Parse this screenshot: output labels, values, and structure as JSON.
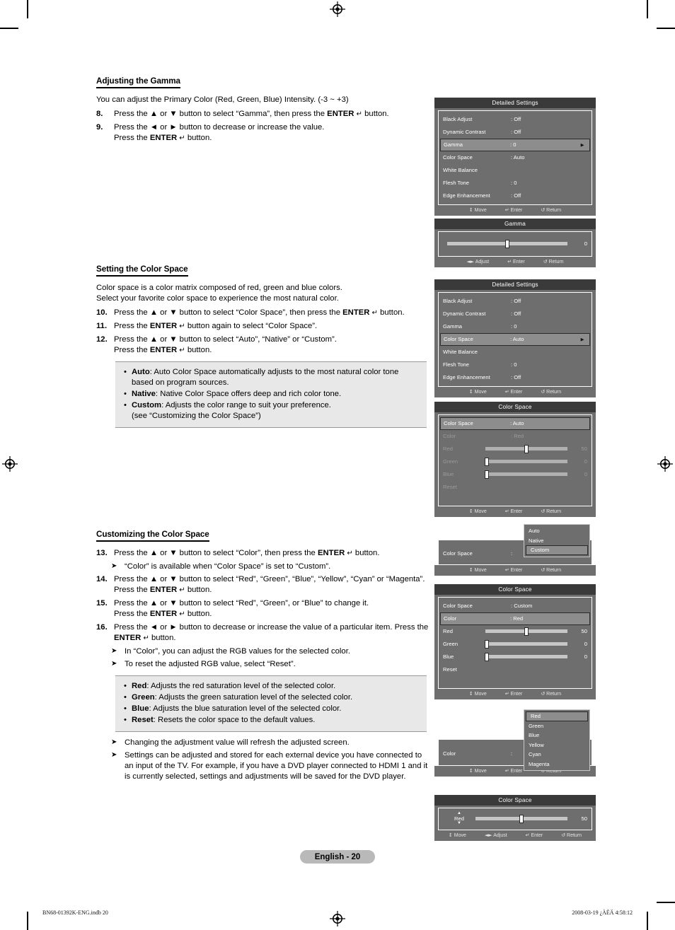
{
  "document": {
    "page_badge": "English - 20",
    "footer_left": "BN68-01392K-ENG.indb  20",
    "footer_right": "2008-03-19   ¿ÀÈÄ 4:58:12"
  },
  "sections": {
    "gamma": {
      "heading": "Adjusting the Gamma",
      "lead": "You can adjust the Primary Color (Red, Green, Blue) Intensity. (-3 ~ +3)",
      "steps": [
        {
          "num": "8.",
          "html": "Press the ▲ or ▼ button to select “Gamma”, then press the <b>ENTER</b> <span class=\"ent\">↵</span> button."
        },
        {
          "num": "9.",
          "html": "Press the ◄ or ► button to decrease or increase the value.<br>Press the <b>ENTER</b> <span class=\"ent\">↵</span> button."
        }
      ]
    },
    "color_space": {
      "heading": "Setting the Color Space",
      "lead": "Color space is a color matrix composed of red, green and blue colors.<br>Select your favorite color space to experience the most natural color.",
      "steps": [
        {
          "num": "10.",
          "html": "Press the ▲ or ▼ button to select “Color Space”, then press the <b>ENTER</b> <span class=\"ent\">↵</span> button."
        },
        {
          "num": "11.",
          "html": "Press the <b>ENTER</b> <span class=\"ent\">↵</span> button again to select “Color Space”."
        },
        {
          "num": "12.",
          "html": "Press the ▲ or ▼ button to select “Auto”, “Native” or “Custom”.<br>Press the <b>ENTER</b> <span class=\"ent\">↵</span> button."
        }
      ],
      "notebox": [
        "<b>Auto</b>: Auto Color Space automatically adjusts to the most natural color tone based on program sources.",
        "<b>Native</b>: Native Color Space offers deep and rich color tone.",
        "<b>Custom</b>: Adjusts the color range to suit your preference.<br>(see “Customizing the Color Space”)"
      ]
    },
    "customizing": {
      "heading": "Customizing the Color Space",
      "steps": [
        {
          "num": "13.",
          "html": "Press the ▲ or ▼ button to select “Color”, then press the <b>ENTER</b> <span class=\"ent\">↵</span> button."
        },
        {
          "note": "“Color” is available when “Color Space” is set to “Custom”."
        },
        {
          "num": "14.",
          "html": "Press the ▲ or ▼ button to select “Red”, “Green”, “Blue”, “Yellow”, “Cyan” or “Magenta”. Press the <b>ENTER</b> <span class=\"ent\">↵</span> button."
        },
        {
          "num": "15.",
          "html": "Press the ▲ or ▼ button to select “Red”, “Green”, or “Blue” to change it.<br>Press the <b>ENTER</b> <span class=\"ent\">↵</span> button."
        },
        {
          "num": "16.",
          "html": "Press the ◄ or ► button to decrease or increase the value of a particular item. Press the <b>ENTER</b> <span class=\"ent\">↵</span> button."
        },
        {
          "note": "In “Color”, you can adjust the RGB values for the selected color."
        },
        {
          "note": "To reset the adjusted RGB value, select “Reset”."
        }
      ],
      "notebox": [
        "<b>Red</b>: Adjusts the red saturation level of the selected color.",
        "<b>Green</b>: Adjusts the green saturation level of the selected color.",
        "<b>Blue</b>: Adjusts the blue saturation level of the selected color.",
        "<b>Reset</b>: Resets the color space to the default values."
      ],
      "tail_notes": [
        "Changing the adjustment value will refresh the adjusted screen.",
        "Settings can be adjusted and stored for each external device you have connected to an input of the TV. For example, if you have a DVD player connected to HDMI 1 and it is currently selected, settings and adjustments will be saved for the DVD player."
      ]
    }
  },
  "osd_common": {
    "footer_move": "Move",
    "footer_adjust": "Adjust",
    "footer_enter": "Enter",
    "footer_return": "Return"
  },
  "osd": {
    "detailed_settings_1": {
      "title": "Detailed Settings",
      "rows": [
        {
          "label": "Black Adjust",
          "value": ": Off",
          "selected": false
        },
        {
          "label": "Dynamic Contrast",
          "value": ": Off",
          "selected": false
        },
        {
          "label": "Gamma",
          "value": ": 0",
          "selected": true
        },
        {
          "label": "Color Space",
          "value": ": Auto",
          "selected": false
        },
        {
          "label": "White Balance",
          "value": "",
          "selected": false
        },
        {
          "label": "Flesh Tone",
          "value": ": 0",
          "selected": false
        },
        {
          "label": "Edge Enhancement",
          "value": ": Off",
          "selected": false
        }
      ]
    },
    "gamma_slider": {
      "title": "Gamma",
      "value": "0",
      "knob_percent": 50
    },
    "detailed_settings_2": {
      "title": "Detailed Settings",
      "rows": [
        {
          "label": "Black Adjust",
          "value": ": Off",
          "selected": false
        },
        {
          "label": "Dynamic Contrast",
          "value": ": Off",
          "selected": false
        },
        {
          "label": "Gamma",
          "value": ": 0",
          "selected": false
        },
        {
          "label": "Color Space",
          "value": ": Auto",
          "selected": true
        },
        {
          "label": "White Balance",
          "value": "",
          "selected": false
        },
        {
          "label": "Flesh Tone",
          "value": ": 0",
          "selected": false
        },
        {
          "label": "Edge Enhancement",
          "value": ": Off",
          "selected": false
        }
      ]
    },
    "color_space_auto": {
      "title": "Color Space",
      "rows": [
        {
          "label": "Color Space",
          "value": ": Auto",
          "selected": true,
          "dim": false
        },
        {
          "label": "Color",
          "value": ": Red",
          "selected": false,
          "dim": true
        }
      ],
      "sliders": [
        {
          "label": "Red",
          "value": "50",
          "percent": 50,
          "dim": true
        },
        {
          "label": "Green",
          "value": "0",
          "percent": 0,
          "dim": true
        },
        {
          "label": "Blue",
          "value": "0",
          "percent": 0,
          "dim": true
        }
      ],
      "reset_label": "Reset",
      "reset_dim": true
    },
    "color_space_dropdown": {
      "row_label": "Color Space",
      "row_colon": ":",
      "options": [
        "Auto",
        "Native",
        "Custom"
      ],
      "selected": "Custom"
    },
    "color_space_custom": {
      "title": "Color Space",
      "rows": [
        {
          "label": "Color Space",
          "value": ": Custom",
          "selected": false,
          "dim": false
        },
        {
          "label": "Color",
          "value": ": Red",
          "selected": true,
          "dim": false
        }
      ],
      "sliders": [
        {
          "label": "Red",
          "value": "50",
          "percent": 50,
          "dim": false
        },
        {
          "label": "Green",
          "value": "0",
          "percent": 0,
          "dim": false
        },
        {
          "label": "Blue",
          "value": "0",
          "percent": 0,
          "dim": false
        }
      ],
      "reset_label": "Reset",
      "reset_dim": false
    },
    "color_dropdown": {
      "row_label": "Color",
      "row_colon": ":",
      "options": [
        "Red",
        "Green",
        "Blue",
        "Yellow",
        "Cyan",
        "Magenta"
      ],
      "selected": "Red"
    },
    "color_space_adjust": {
      "title": "Color Space",
      "item_label": "Red",
      "value": "50",
      "knob_percent": 50
    }
  }
}
